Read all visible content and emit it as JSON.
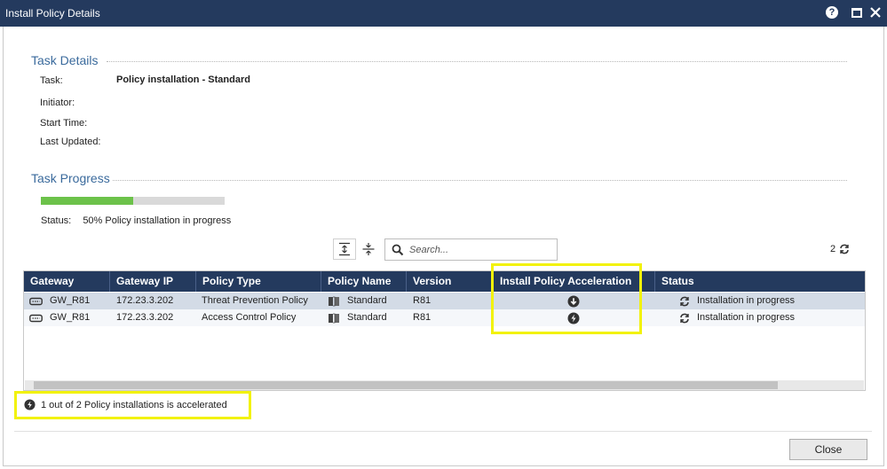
{
  "window": {
    "title": "Install Policy Details",
    "help_icon": "?"
  },
  "task_details": {
    "heading": "Task Details",
    "fields": [
      {
        "label": "Task:",
        "value": "Policy installation - Standard"
      },
      {
        "label": "Initiator:",
        "value": ""
      },
      {
        "label": "Start Time:",
        "value": ""
      },
      {
        "label": "Last Updated:",
        "value": ""
      }
    ]
  },
  "task_progress": {
    "heading": "Task Progress",
    "percent": 50,
    "status_label": "Status:",
    "status_text": "50% Policy installation in progress"
  },
  "toolbar": {
    "search_placeholder": "Search...",
    "row_count": "2"
  },
  "table": {
    "columns": [
      "Gateway",
      "Gateway IP",
      "Policy Type",
      "Policy Name",
      "Version",
      "Install Policy Acceleration",
      "Status"
    ],
    "rows": [
      {
        "gateway": "GW_R81",
        "ip": "172.23.3.202",
        "policy_type": "Threat Prevention Policy",
        "policy_name": "Standard",
        "version": "R81",
        "acceleration_icon": "download-circle-icon",
        "status": "Installation in progress"
      },
      {
        "gateway": "GW_R81",
        "ip": "172.23.3.202",
        "policy_type": "Access Control Policy",
        "policy_name": "Standard",
        "version": "R81",
        "acceleration_icon": "lightning-circle-icon",
        "status": "Installation in progress"
      }
    ]
  },
  "acceleration_note": "1 out of 2 Policy installations is accelerated",
  "footer": {
    "close_label": "Close"
  },
  "colors": {
    "header_bg": "#243a5e",
    "section_title": "#3a6a9c",
    "progress_fill": "#6cc24a",
    "highlight": "#f2f20a",
    "selected_row": "#d3dbe6"
  }
}
